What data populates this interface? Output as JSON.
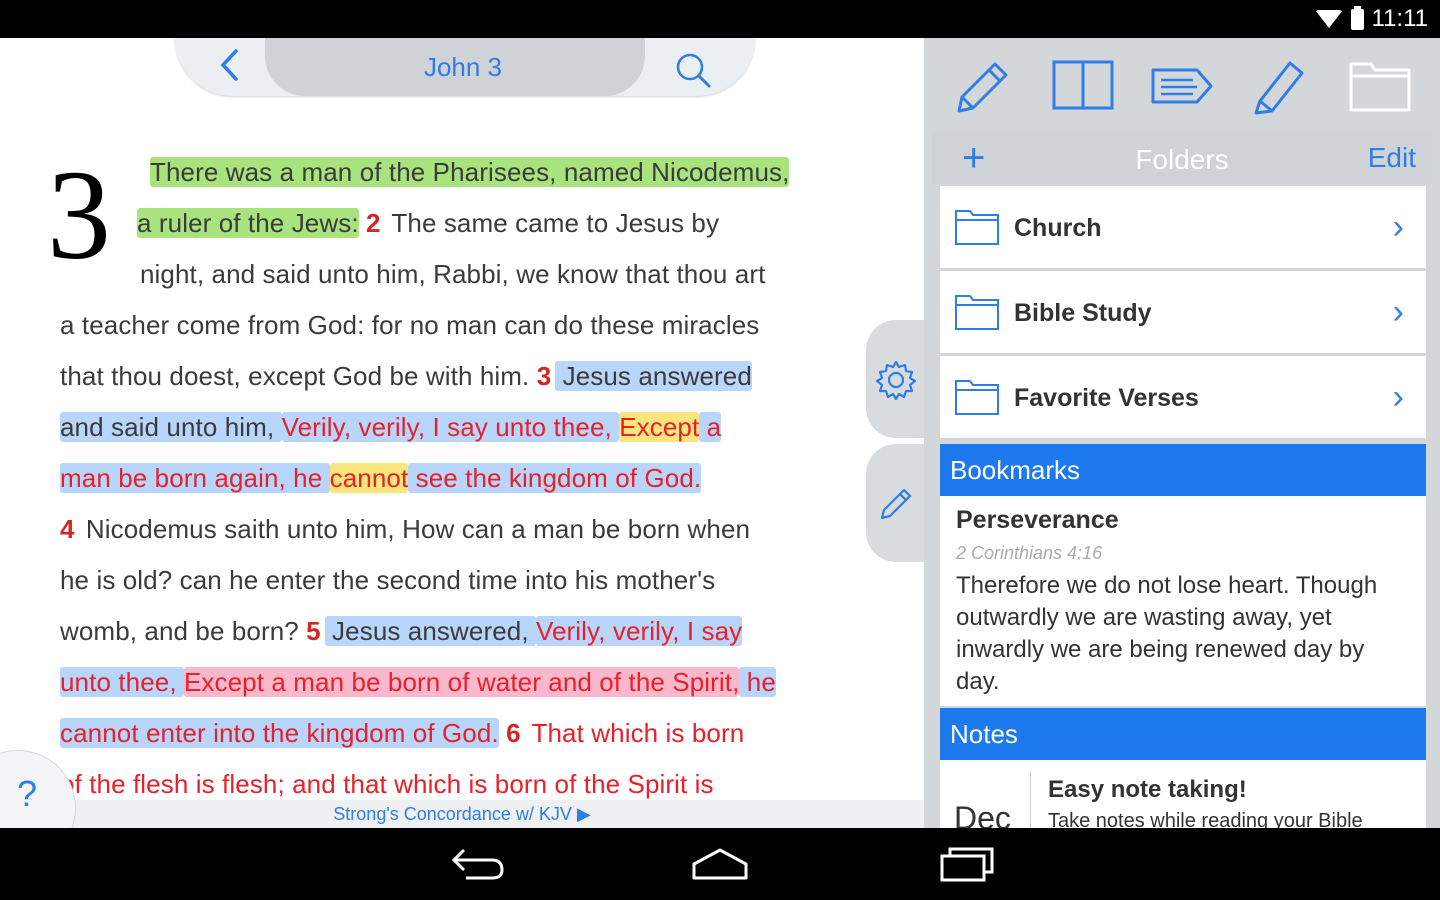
{
  "status_bar": {
    "time": "11:11"
  },
  "reader": {
    "title": "John 3",
    "chapter_number": "3",
    "lines": [
      [
        {
          "t": "There was a man of the Pharisees, named Nicodemus,",
          "c": "hl-green"
        }
      ],
      [
        {
          "t": "a ruler of the Jews:",
          "c": "hl-green"
        },
        {
          "t": " "
        },
        {
          "t": "2",
          "c": "verse-num"
        },
        {
          "t": " The same came to Jesus by"
        }
      ],
      [
        {
          "t": "night, and said unto him, Rabbi, we know that thou art"
        }
      ],
      [
        {
          "t": "a teacher come from God: for no man can do these miracles"
        }
      ],
      [
        {
          "t": "that thou doest, except God be with him. "
        },
        {
          "t": "3",
          "c": "verse-num"
        },
        {
          "t": " Jesus answered",
          "c": "hl-blue"
        }
      ],
      [
        {
          "t": "and said unto him, ",
          "c": "hl-blue"
        },
        {
          "t": "Verily, verily, I say unto thee, ",
          "c": "hl-blue red"
        },
        {
          "t": "Except",
          "c": "hl-yellow red"
        },
        {
          "t": " a",
          "c": "hl-blue red"
        }
      ],
      [
        {
          "t": "man be born again, he ",
          "c": "hl-blue red"
        },
        {
          "t": "cannot",
          "c": "hl-yellow red"
        },
        {
          "t": " see the kingdom of God.",
          "c": "hl-blue red"
        }
      ],
      [
        {
          "t": "4",
          "c": "verse-num"
        },
        {
          "t": " Nicodemus saith unto him, How can a man be born when"
        }
      ],
      [
        {
          "t": "he is old? can he enter the second time into his mother's"
        }
      ],
      [
        {
          "t": "womb, and be born? "
        },
        {
          "t": "5",
          "c": "verse-num"
        },
        {
          "t": " Jesus answered, ",
          "c": "hl-blue"
        },
        {
          "t": "Verily, verily, I say",
          "c": "hl-blue red"
        }
      ],
      [
        {
          "t": "unto thee, ",
          "c": "hl-blue red"
        },
        {
          "t": "Except a man be born of water and of the Spirit,",
          "c": "hl-pink red"
        },
        {
          "t": " he",
          "c": "hl-blue red"
        }
      ],
      [
        {
          "t": "cannot enter into the kingdom of God.",
          "c": "hl-blue red"
        },
        {
          "t": " "
        },
        {
          "t": "6",
          "c": "verse-num"
        },
        {
          "t": " That which is born",
          "c": "red"
        }
      ],
      [
        {
          "t": "of the flesh is flesh; and that which is born of the Spirit is",
          "c": "red"
        }
      ]
    ],
    "strongs_label": "Strong's Concordance w/ KJV ▶",
    "help_label": "?"
  },
  "panel": {
    "folders_title": "Folders",
    "add_label": "+",
    "edit_label": "Edit",
    "folders": [
      {
        "label": "Church"
      },
      {
        "label": "Bible Study"
      },
      {
        "label": "Favorite Verses"
      }
    ],
    "bookmarks_header": "Bookmarks",
    "bookmark": {
      "title": "Perseverance",
      "reference": "2 Corinthians 4:16",
      "text": "Therefore we do not lose heart. Though outwardly we are wasting away, yet inwardly we are being renewed day by day."
    },
    "notes_header": "Notes",
    "note": {
      "date": "Dec",
      "title": "Easy note taking!",
      "text": "Take notes while reading your Bible"
    }
  },
  "colors": {
    "accent": "#2f7de6",
    "header_blue": "#1e78ee",
    "highlight_green": "#a8e37d",
    "highlight_blue": "#b8d6fb",
    "highlight_yellow": "#fbe67d",
    "highlight_pink": "#fbb7cb",
    "words_of_christ": "#e8202a"
  },
  "icons": [
    "wifi-icon",
    "battery-icon",
    "back-icon",
    "search-icon",
    "settings-icon",
    "pencil-icon",
    "edit-pencil-icon",
    "book-icon",
    "tag-icon",
    "highlighter-icon",
    "folder-icon",
    "chevron-right-icon",
    "nav-back-icon",
    "nav-home-icon",
    "nav-recents-icon"
  ]
}
